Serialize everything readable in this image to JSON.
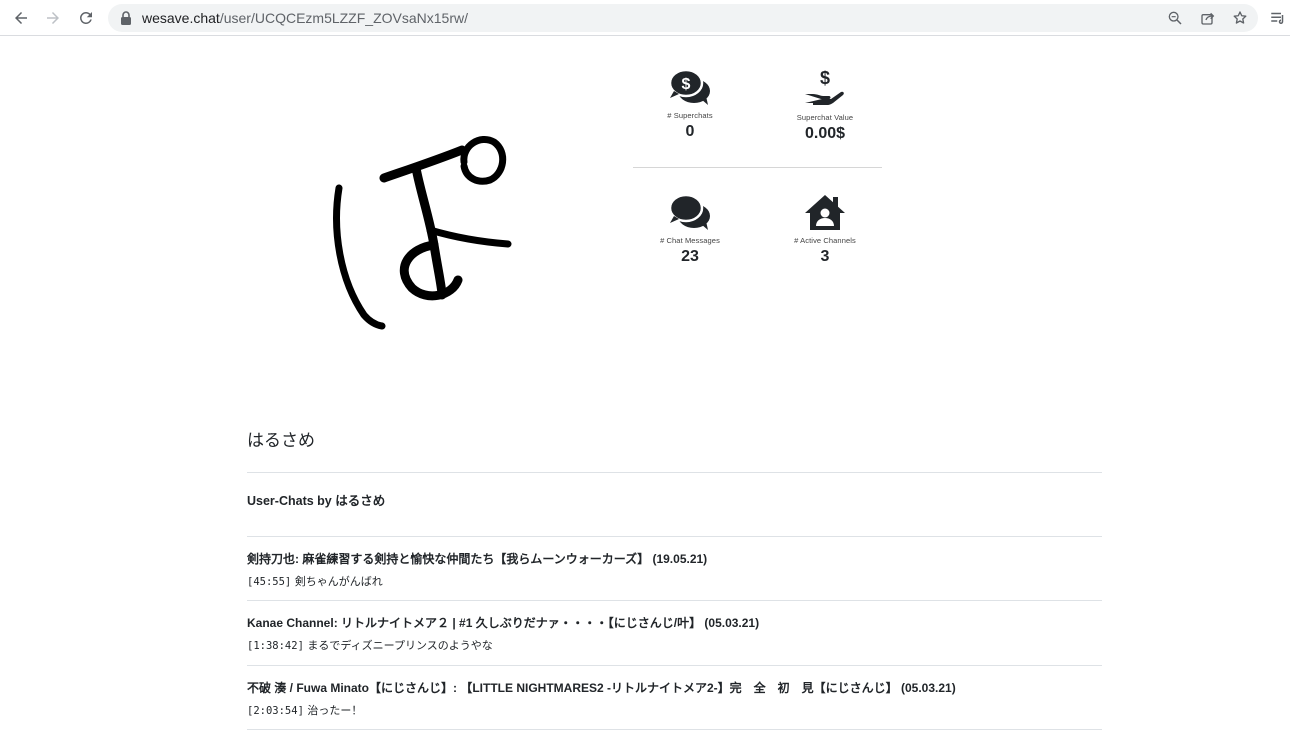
{
  "browser": {
    "url_domain": "wesave.chat",
    "url_path": "/user/UCQCEzm5LZZF_ZOVsaNx15rw/"
  },
  "stats": [
    {
      "label": "# Superchats",
      "value": "0",
      "icon": "superchat-dollar-bubbles-icon"
    },
    {
      "label": "Superchat Value",
      "value": "0.00$",
      "icon": "hand-holding-dollar-icon"
    },
    {
      "label": "# Chat Messages",
      "value": "23",
      "icon": "chat-bubbles-icon"
    },
    {
      "label": "# Active Channels",
      "value": "3",
      "icon": "house-user-icon"
    }
  ],
  "user": {
    "name": "はるさめ",
    "chats_heading_prefix": "User-Chats by ",
    "chats_heading_name": "はるさめ"
  },
  "chats": [
    {
      "title": "剣持刀也: 麻雀練習する剣持と愉快な仲間たち【我らムーンウォーカーズ】 (19.05.21)",
      "time": "[45:55]",
      "message": "剣ちゃんがんばれ"
    },
    {
      "title": "Kanae Channel: リトルナイトメア２ | #1 久しぶりだナァ・・・・【にじさんじ/叶】 (05.03.21)",
      "time": "[1:38:42]",
      "message": "まるでディズニープリンスのようやな"
    },
    {
      "title": "不破 湊 / Fuwa Minato【にじさんじ】: 【LITTLE NIGHTMARES2 -リトルナイトメア2-】完　全　初　見【にじさんじ】 (05.03.21)",
      "time": "[2:03:54]",
      "message": "治ったー！"
    }
  ],
  "colors": {
    "text": "#212529",
    "divider": "#dee2e6",
    "omnibox": "#f1f3f4"
  }
}
